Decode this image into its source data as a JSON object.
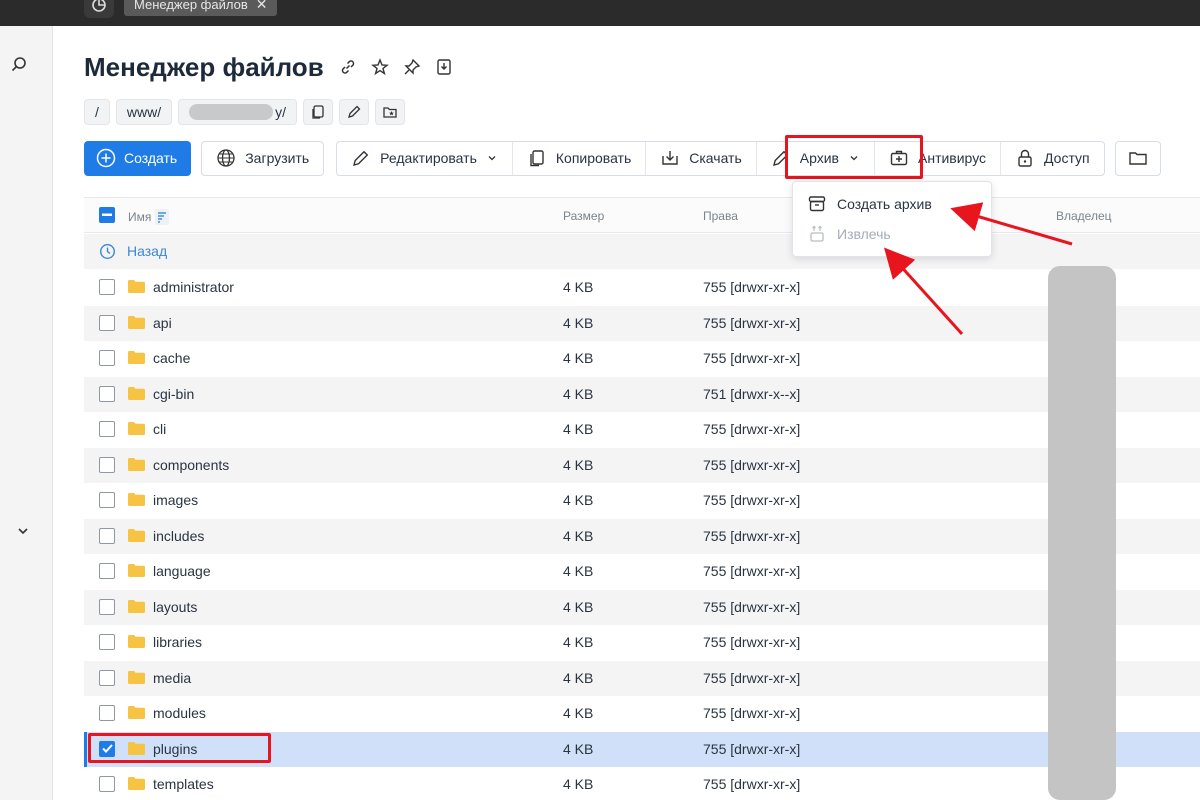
{
  "window": {
    "tab_title": "Менеджер файлов",
    "tab_close_icon": "close-icon"
  },
  "page": {
    "title": "Менеджер файлов"
  },
  "breadcrumb": {
    "root": "/",
    "level1": "www/",
    "level2_suffix": "y/"
  },
  "toolbar": {
    "create": "Создать",
    "upload": "Загрузить",
    "edit": "Редактировать",
    "copy": "Копировать",
    "download": "Скачать",
    "archive": "Архив",
    "antivirus": "Антивирус",
    "access": "Доступ"
  },
  "archive_menu": {
    "create_archive": "Создать архив",
    "extract": "Извлечь"
  },
  "table": {
    "columns": {
      "name": "Имя",
      "size": "Размер",
      "rights": "Права",
      "owner": "Владелец"
    },
    "back_label": "Назад",
    "rows": [
      {
        "name": "administrator",
        "size": "4 KB",
        "rights": "755 [drwxr-xr-x]",
        "checked": false
      },
      {
        "name": "api",
        "size": "4 KB",
        "rights": "755 [drwxr-xr-x]",
        "checked": false
      },
      {
        "name": "cache",
        "size": "4 KB",
        "rights": "755 [drwxr-xr-x]",
        "checked": false
      },
      {
        "name": "cgi-bin",
        "size": "4 KB",
        "rights": "751 [drwxr-x--x]",
        "checked": false
      },
      {
        "name": "cli",
        "size": "4 KB",
        "rights": "755 [drwxr-xr-x]",
        "checked": false
      },
      {
        "name": "components",
        "size": "4 KB",
        "rights": "755 [drwxr-xr-x]",
        "checked": false
      },
      {
        "name": "images",
        "size": "4 KB",
        "rights": "755 [drwxr-xr-x]",
        "checked": false
      },
      {
        "name": "includes",
        "size": "4 KB",
        "rights": "755 [drwxr-xr-x]",
        "checked": false
      },
      {
        "name": "language",
        "size": "4 KB",
        "rights": "755 [drwxr-xr-x]",
        "checked": false
      },
      {
        "name": "layouts",
        "size": "4 KB",
        "rights": "755 [drwxr-xr-x]",
        "checked": false
      },
      {
        "name": "libraries",
        "size": "4 KB",
        "rights": "755 [drwxr-xr-x]",
        "checked": false
      },
      {
        "name": "media",
        "size": "4 KB",
        "rights": "755 [drwxr-xr-x]",
        "checked": false
      },
      {
        "name": "modules",
        "size": "4 KB",
        "rights": "755 [drwxr-xr-x]",
        "checked": false
      },
      {
        "name": "plugins",
        "size": "4 KB",
        "rights": "755 [drwxr-xr-x]",
        "checked": true
      },
      {
        "name": "templates",
        "size": "4 KB",
        "rights": "755 [drwxr-xr-x]",
        "checked": false
      }
    ]
  },
  "colors": {
    "primary": "#1f7be6",
    "annotation": "#e8141e",
    "folder": "#f6c343",
    "selected_row": "#cfe0f8",
    "link": "#3b87d6"
  }
}
